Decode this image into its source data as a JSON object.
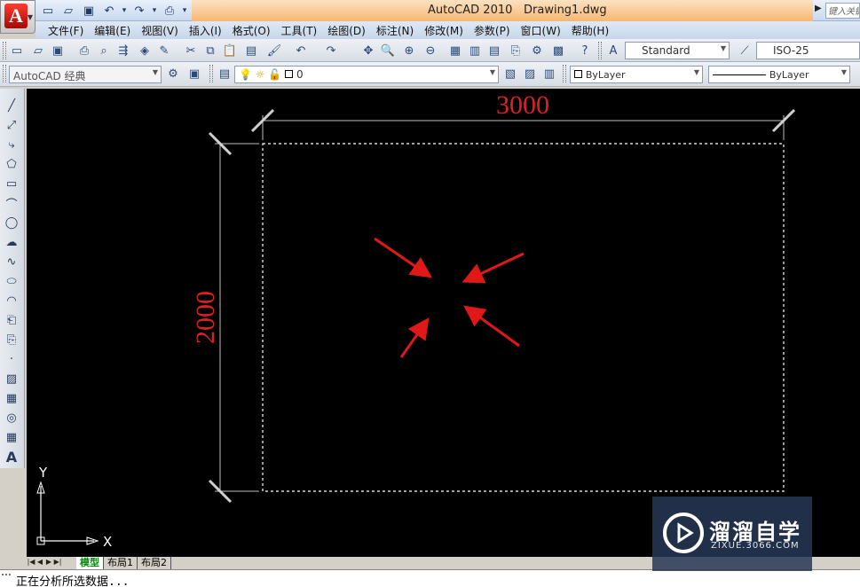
{
  "titlebar": {
    "app_name": "AutoCAD 2010",
    "file_name": "Drawing1.dwg",
    "search_placeholder": "键入关键字"
  },
  "menu": [
    "文件(F)",
    "编辑(E)",
    "视图(V)",
    "插入(I)",
    "格式(O)",
    "工具(T)",
    "绘图(D)",
    "标注(N)",
    "修改(M)",
    "参数(P)",
    "窗口(W)",
    "帮助(H)"
  ],
  "toolbar": {
    "text_style": "Standard",
    "dim_style": "ISO-25"
  },
  "toolbar2": {
    "workspace": "AutoCAD 经典",
    "layer": "0",
    "color": "ByLayer",
    "linetype": "ByLayer"
  },
  "drawing": {
    "dim_horizontal": "3000",
    "dim_vertical": "2000",
    "ucs_x": "X",
    "ucs_y": "Y",
    "dim_color": "#e02020",
    "arrow_color": "#e01818"
  },
  "tabs": {
    "model": "模型",
    "layout1": "布局1",
    "layout2": "布局2"
  },
  "command": {
    "text": "正在分析所选数据..."
  },
  "watermark": {
    "title": "溜溜自学",
    "subtitle": "ZIXUE.3066.COM"
  }
}
